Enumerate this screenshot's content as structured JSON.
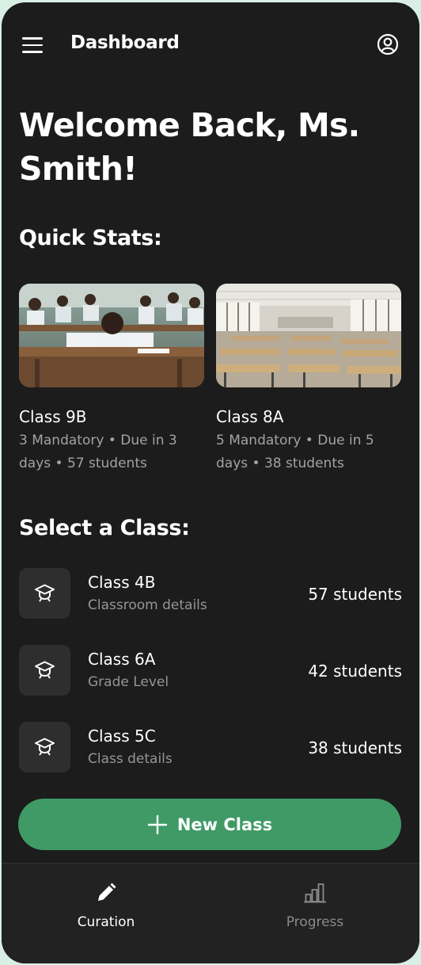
{
  "header": {
    "title": "Dashboard"
  },
  "welcome": "Welcome Back, Ms. Smith!",
  "quick_stats": {
    "title": "Quick Stats:",
    "cards": [
      {
        "name": "Class 9B",
        "meta": "3 Mandatory • Due in 3 days • 57 students",
        "image": "classroom-with-students-photo"
      },
      {
        "name": "Class 8A",
        "meta": "5 Mandatory • Due in 5 days • 38 students",
        "image": "empty-classroom-photo"
      }
    ]
  },
  "select_class": {
    "title": "Select a Class:",
    "items": [
      {
        "name": "Class 4B",
        "subtitle": "Classroom details",
        "count": "57 students",
        "icon": "graduation-cap-icon"
      },
      {
        "name": "Class 6A",
        "subtitle": "Grade Level",
        "count": "42 students",
        "icon": "graduation-cap-icon"
      },
      {
        "name": "Class 5C",
        "subtitle": "Class details",
        "count": "38 students",
        "icon": "graduation-cap-icon"
      }
    ]
  },
  "new_class_button": {
    "label": "New Class",
    "icon": "plus-icon",
    "color": "#3f9a66"
  },
  "bottom_nav": {
    "items": [
      {
        "label": "Curation",
        "icon": "pencil-icon",
        "active": true
      },
      {
        "label": "Progress",
        "icon": "bar-chart-icon",
        "active": false
      }
    ]
  },
  "colors": {
    "background": "#1c1c1c",
    "accent": "#3f9a66",
    "muted_text": "#a3a3a3"
  }
}
